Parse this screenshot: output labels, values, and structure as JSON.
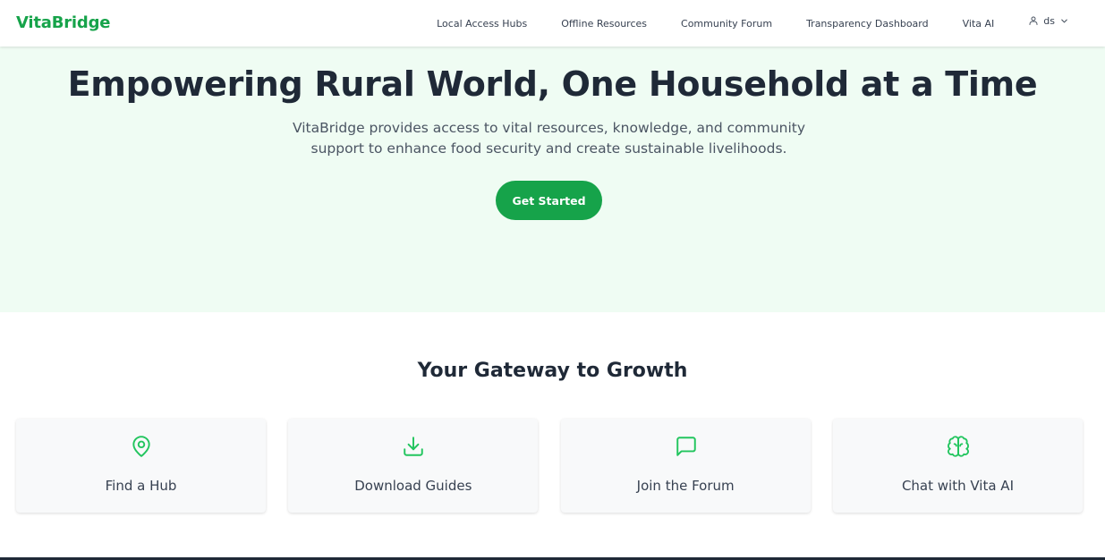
{
  "header": {
    "brand": "VitaBridge",
    "nav": [
      {
        "label": "Local Access Hubs"
      },
      {
        "label": "Offline Resources"
      },
      {
        "label": "Community Forum"
      },
      {
        "label": "Transparency Dashboard"
      },
      {
        "label": "Vita AI"
      }
    ],
    "user": {
      "name": "ds",
      "icon": "user-icon",
      "chevron": "chevron-down-icon"
    }
  },
  "hero": {
    "title": "Empowering Rural World, One Household at a Time",
    "subtitle": "VitaBridge provides access to vital resources, knowledge, and community support to enhance food security and create sustainable livelihoods.",
    "cta_label": "Get Started"
  },
  "gateway": {
    "title": "Your Gateway to Growth",
    "cards": [
      {
        "label": "Find a Hub",
        "icon": "map-pin-icon"
      },
      {
        "label": "Download Guides",
        "icon": "download-icon"
      },
      {
        "label": "Join the Forum",
        "icon": "message-square-icon"
      },
      {
        "label": "Chat with Vita AI",
        "icon": "brain-icon"
      }
    ]
  },
  "colors": {
    "brand": "#16a34a",
    "hero_bg": "#effcf3",
    "card_bg": "#f8f9fa",
    "text_dark": "#1f2937"
  }
}
